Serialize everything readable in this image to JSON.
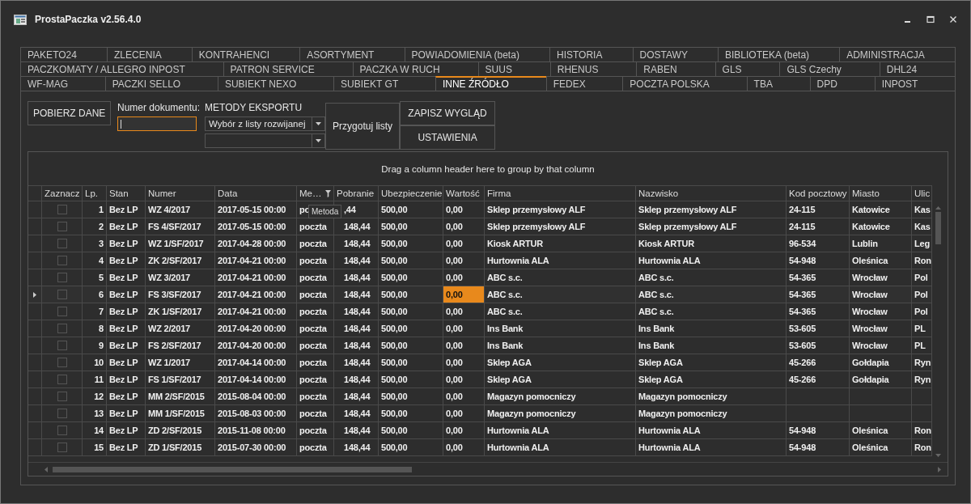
{
  "window": {
    "title": "ProstaPaczka v2.56.4.0"
  },
  "tab_rows": [
    [
      {
        "label": "PAKETO24",
        "selected": false
      },
      {
        "label": "ZLECENIA",
        "selected": false
      },
      {
        "label": "KONTRAHENCI",
        "selected": false
      },
      {
        "label": "ASORTYMENT",
        "selected": false
      },
      {
        "label": "POWIADOMIENIA (beta)",
        "selected": false
      },
      {
        "label": "HISTORIA",
        "selected": false
      },
      {
        "label": "DOSTAWY",
        "selected": false
      },
      {
        "label": "BIBLIOTEKA (beta)",
        "selected": false
      },
      {
        "label": "ADMINISTRACJA",
        "selected": false
      }
    ],
    [
      {
        "label": "PACZKOMATY / ALLEGRO INPOST",
        "selected": false
      },
      {
        "label": "PATRON SERVICE",
        "selected": false
      },
      {
        "label": "PACZKA W RUCH",
        "selected": false
      },
      {
        "label": "SUUS",
        "selected": false
      },
      {
        "label": "RHENUS",
        "selected": false
      },
      {
        "label": "RABEN",
        "selected": false
      },
      {
        "label": "GLS",
        "selected": false
      },
      {
        "label": "GLS Czechy",
        "selected": false
      },
      {
        "label": "DHL24",
        "selected": false
      }
    ],
    [
      {
        "label": "WF-MAG",
        "selected": false
      },
      {
        "label": "PACZKI SELLO",
        "selected": false
      },
      {
        "label": "SUBIEKT NEXO",
        "selected": false
      },
      {
        "label": "SUBIEKT GT",
        "selected": false
      },
      {
        "label": "INNE ŹRÓDŁO",
        "selected": true
      },
      {
        "label": "FEDEX",
        "selected": false
      },
      {
        "label": "POCZTA POLSKA",
        "selected": false
      },
      {
        "label": "TBA",
        "selected": false
      },
      {
        "label": "DPD",
        "selected": false
      },
      {
        "label": "INPOST",
        "selected": false
      }
    ]
  ],
  "toolbar": {
    "fetch_button": "POBIERZ DANE",
    "document_label": "Numer dokumentu:",
    "export_label": "METODY EKSPORTU",
    "export_combo": "Wybór z listy rozwijanej",
    "prepare_button": "Przygotuj listy",
    "save_layout_button": "ZAPISZ WYGLĄD",
    "settings_button": "USTAWIENIA"
  },
  "table": {
    "group_hint": "Drag a column header here to group by that column",
    "checkbox_column": "Zaznacz",
    "columns": [
      "Lp.",
      "Stan",
      "Numer",
      "Data",
      "Me…",
      "Pobranie",
      "Ubezpieczenie",
      "Wartość",
      "Firma",
      "Nazwisko",
      "Kod pocztowy",
      "Miasto",
      "Ulic"
    ],
    "tooltip": "Metoda",
    "rows": [
      {
        "checked": false,
        "selected": false,
        "cells": [
          "1",
          "Bez LP",
          "WZ 4/2017",
          "2017-05-15 00:00",
          "po",
          ",44",
          "500,00",
          "0,00",
          "Sklep przemysłowy ALF",
          "Sklep przemysłowy ALF",
          "24-115",
          "Katowice",
          "Kas"
        ]
      },
      {
        "checked": false,
        "selected": false,
        "cells": [
          "2",
          "Bez LP",
          "FS 4/SF/2017",
          "2017-05-15 00:00",
          "poczta",
          "148,44",
          "500,00",
          "0,00",
          "Sklep przemysłowy ALF",
          "Sklep przemysłowy ALF",
          "24-115",
          "Katowice",
          "Kas"
        ]
      },
      {
        "checked": false,
        "selected": false,
        "cells": [
          "3",
          "Bez LP",
          "WZ 1/SF/2017",
          "2017-04-28 00:00",
          "poczta",
          "148,44",
          "500,00",
          "0,00",
          "Kiosk ARTUR",
          "Kiosk ARTUR",
          "96-534",
          "Lublin",
          "Leg"
        ]
      },
      {
        "checked": false,
        "selected": false,
        "cells": [
          "4",
          "Bez LP",
          "ZK 2/SF/2017",
          "2017-04-21 00:00",
          "poczta",
          "148,44",
          "500,00",
          "0,00",
          "Hurtownia ALA",
          "Hurtownia ALA",
          "54-948",
          "Oleśnica",
          "Ron"
        ]
      },
      {
        "checked": false,
        "selected": false,
        "cells": [
          "5",
          "Bez LP",
          "WZ 3/2017",
          "2017-04-21 00:00",
          "poczta",
          "148,44",
          "500,00",
          "0,00",
          "ABC s.c.",
          "ABC s.c.",
          "54-365",
          "Wrocław",
          "Pol"
        ]
      },
      {
        "checked": false,
        "selected": true,
        "cells": [
          "6",
          "Bez LP",
          "FS 3/SF/2017",
          "2017-04-21 00:00",
          "poczta",
          "148,44",
          "500,00",
          "0,00",
          "ABC s.c.",
          "ABC s.c.",
          "54-365",
          "Wrocław",
          "Pol"
        ]
      },
      {
        "checked": false,
        "selected": false,
        "cells": [
          "7",
          "Bez LP",
          "ZK 1/SF/2017",
          "2017-04-21 00:00",
          "poczta",
          "148,44",
          "500,00",
          "0,00",
          "ABC s.c.",
          "ABC s.c.",
          "54-365",
          "Wrocław",
          "Pol"
        ]
      },
      {
        "checked": false,
        "selected": false,
        "cells": [
          "8",
          "Bez LP",
          "WZ 2/2017",
          "2017-04-20 00:00",
          "poczta",
          "148,44",
          "500,00",
          "0,00",
          "Ins Bank",
          "Ins Bank",
          "53-605",
          "Wrocław",
          "PL"
        ]
      },
      {
        "checked": false,
        "selected": false,
        "cells": [
          "9",
          "Bez LP",
          "FS 2/SF/2017",
          "2017-04-20 00:00",
          "poczta",
          "148,44",
          "500,00",
          "0,00",
          "Ins Bank",
          "Ins Bank",
          "53-605",
          "Wrocław",
          "PL"
        ]
      },
      {
        "checked": false,
        "selected": false,
        "cells": [
          "10",
          "Bez LP",
          "WZ 1/2017",
          "2017-04-14 00:00",
          "poczta",
          "148,44",
          "500,00",
          "0,00",
          "Sklep AGA",
          "Sklep AGA",
          "45-266",
          "Gołdapia",
          "Ryn"
        ]
      },
      {
        "checked": false,
        "selected": false,
        "cells": [
          "11",
          "Bez LP",
          "FS 1/SF/2017",
          "2017-04-14 00:00",
          "poczta",
          "148,44",
          "500,00",
          "0,00",
          "Sklep AGA",
          "Sklep AGA",
          "45-266",
          "Gołdapia",
          "Ryn"
        ]
      },
      {
        "checked": false,
        "selected": false,
        "cells": [
          "12",
          "Bez LP",
          "MM 2/SF/2015",
          "2015-08-04 00:00",
          "poczta",
          "148,44",
          "500,00",
          "0,00",
          "Magazyn pomocniczy",
          "Magazyn pomocniczy",
          "",
          "",
          ""
        ]
      },
      {
        "checked": false,
        "selected": false,
        "cells": [
          "13",
          "Bez LP",
          "MM 1/SF/2015",
          "2015-08-03 00:00",
          "poczta",
          "148,44",
          "500,00",
          "0,00",
          "Magazyn pomocniczy",
          "Magazyn pomocniczy",
          "",
          "",
          ""
        ]
      },
      {
        "checked": false,
        "selected": false,
        "cells": [
          "14",
          "Bez LP",
          "ZD 2/SF/2015",
          "2015-11-08 00:00",
          "poczta",
          "148,44",
          "500,00",
          "0,00",
          "Hurtownia ALA",
          "Hurtownia ALA",
          "54-948",
          "Oleśnica",
          "Ron"
        ]
      },
      {
        "checked": false,
        "selected": false,
        "cells": [
          "15",
          "Bez LP",
          "ZD 1/SF/2015",
          "2015-07-30 00:00",
          "poczta",
          "148,44",
          "500,00",
          "0,00",
          "Hurtownia ALA",
          "Hurtownia ALA",
          "54-948",
          "Oleśnica",
          "Ron"
        ]
      }
    ]
  }
}
